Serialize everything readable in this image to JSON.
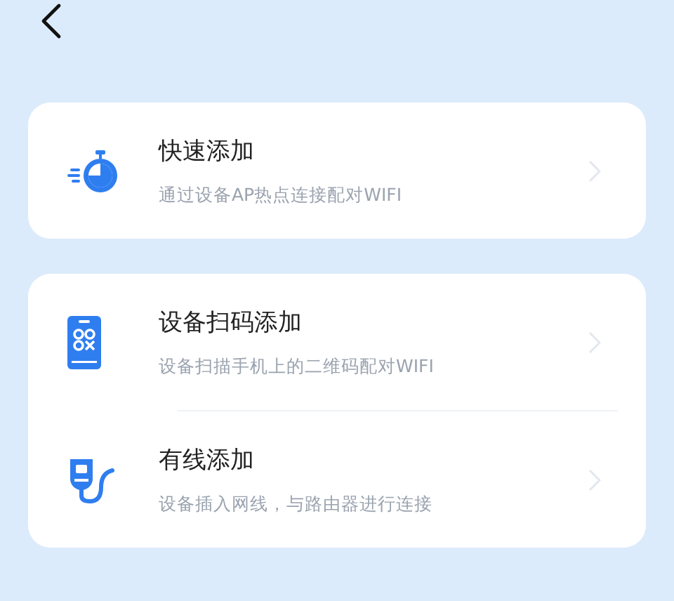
{
  "cards": [
    {
      "items": [
        {
          "kind": "stopwatch",
          "title": "快速添加",
          "subtitle": "通过设备AP热点连接配对WIFI"
        }
      ]
    },
    {
      "items": [
        {
          "kind": "phone",
          "title": "设备扫码添加",
          "subtitle": "设备扫描手机上的二维码配对WIFI"
        },
        {
          "kind": "plug",
          "title": "有线添加",
          "subtitle": "设备插入网线，与路由器进行连接"
        }
      ]
    }
  ]
}
